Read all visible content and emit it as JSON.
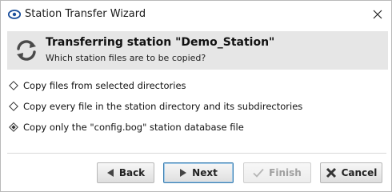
{
  "window": {
    "title": "Station Transfer Wizard"
  },
  "header": {
    "title": "Transferring station \"Demo_Station\"",
    "subtitle": "Which station files are to be copied?"
  },
  "options": [
    {
      "label": "Copy files from selected directories",
      "selected": false
    },
    {
      "label": "Copy every file in the station directory and its subdirectories",
      "selected": false
    },
    {
      "label": "Copy only the \"config.bog\" station database file",
      "selected": true
    }
  ],
  "buttons": {
    "back": "Back",
    "next": "Next",
    "finish": "Finish",
    "cancel": "Cancel"
  },
  "icons": {
    "app": "niagara-logo-icon",
    "header": "sync-arrows-icon"
  },
  "colors": {
    "accent": "#3c7fb1",
    "header_bg": "#e6e6e6",
    "disabled_text": "#a0a0a0"
  }
}
